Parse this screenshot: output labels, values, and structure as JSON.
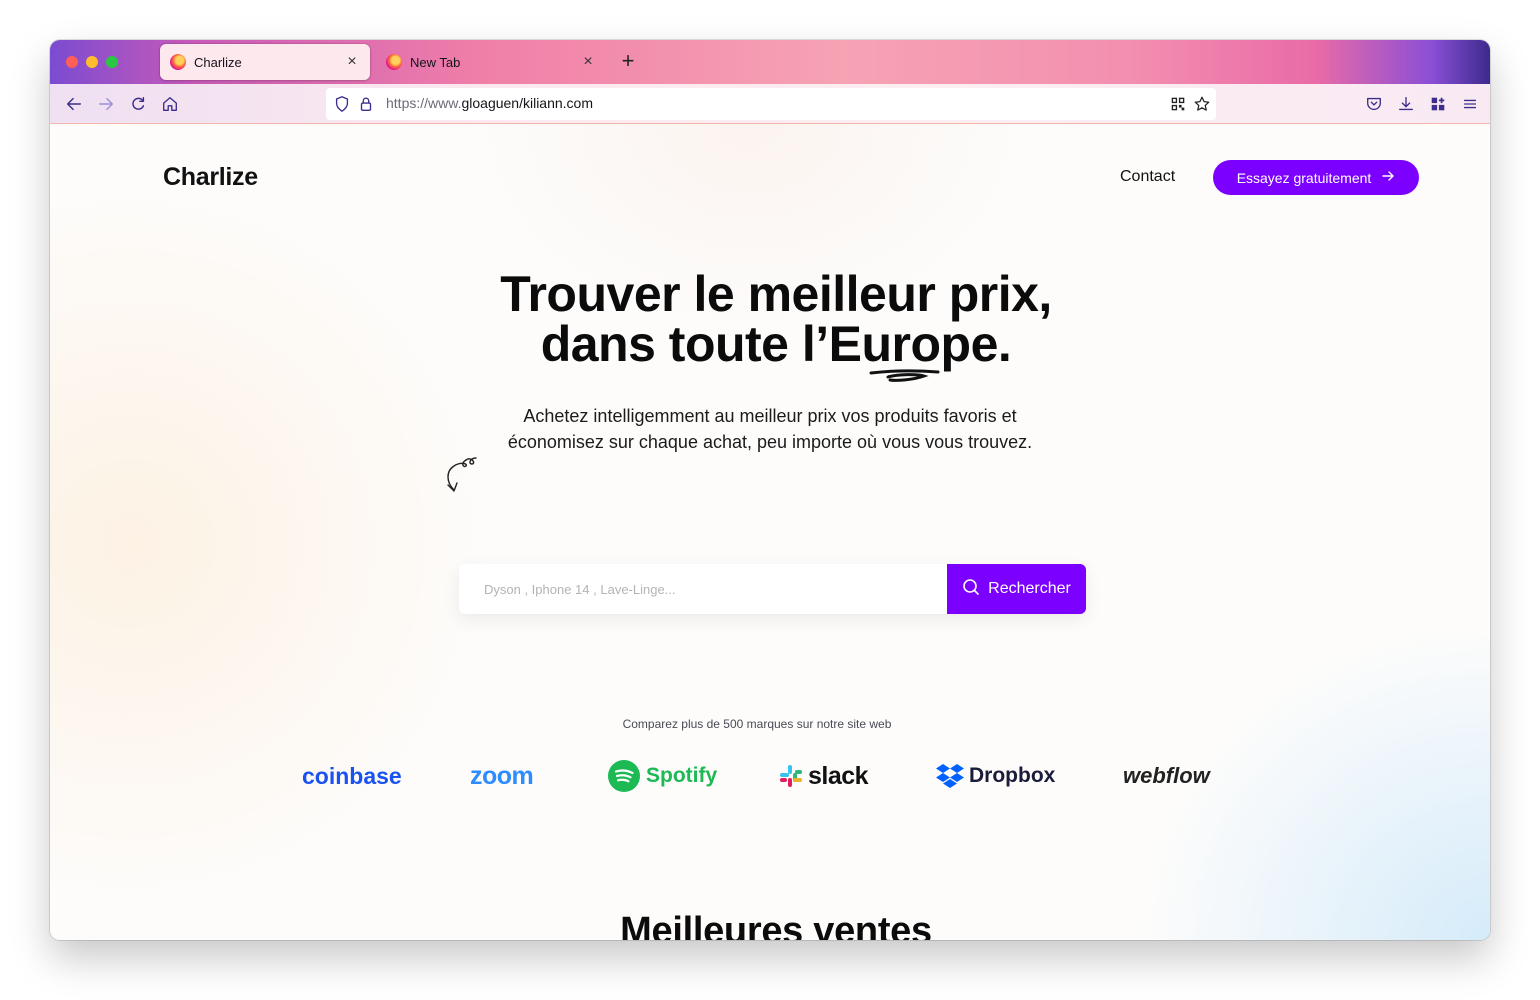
{
  "browser": {
    "tabs": [
      {
        "title": "Charlize",
        "active": true
      },
      {
        "title": "New Tab",
        "active": false
      }
    ],
    "url_prefix": "https://www.",
    "url_main": "gloaguen/kiliann.com"
  },
  "site": {
    "brand": "Charlize",
    "nav": {
      "contact": "Contact",
      "cta": "Essayez gratuitement"
    },
    "hero": {
      "title_line1": "Trouver le meilleur prix,",
      "title_line2": "dans toute l’Europe.",
      "subtitle_line1": "Achetez intelligemment au meilleur prix vos produits favoris et",
      "subtitle_line2": "économisez sur chaque achat, peu importe où vous vous trouvez."
    },
    "search": {
      "placeholder": "Dyson , Iphone 14 , Lave-Linge...",
      "button": "Rechercher"
    },
    "brands": {
      "caption": "Comparez plus de 500 marques sur notre site web",
      "logos": [
        "coinbase",
        "zoom",
        "Spotify",
        "slack",
        "Dropbox",
        "webflow"
      ]
    },
    "best_sellers_title": "Meilleures ventes"
  },
  "colors": {
    "accent": "#7b00ff",
    "coinbase": "#1a52f0",
    "zoom": "#2d8cff",
    "spotify": "#1db954"
  }
}
